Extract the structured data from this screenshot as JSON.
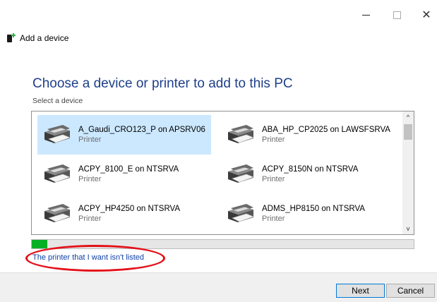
{
  "window": {
    "controls": {
      "minimize": "",
      "maximize": "",
      "close": "✕"
    }
  },
  "header": {
    "icon": "add-device-icon",
    "title": "Add a device"
  },
  "main": {
    "title": "Choose a device or printer to add to this PC",
    "subtitle": "Select a device"
  },
  "device_list": {
    "items": [
      {
        "name": "A_Gaudi_CRO123_P on APSRV06",
        "type": "Printer",
        "icon": "printer-icon",
        "selected": true
      },
      {
        "name": "ABA_HP_CP2025 on LAWSFSRVA",
        "type": "Printer",
        "icon": "printer-icon",
        "selected": false
      },
      {
        "name": "ACPY_8100_E on NTSRVA",
        "type": "Printer",
        "icon": "printer-icon",
        "selected": false
      },
      {
        "name": "ACPY_8150N on NTSRVA",
        "type": "Printer",
        "icon": "printer-icon",
        "selected": false
      },
      {
        "name": "ACPY_HP4250 on NTSRVA",
        "type": "Printer",
        "icon": "printer-icon",
        "selected": false
      },
      {
        "name": "ADMS_HP8150 on NTSRVA",
        "type": "Printer",
        "icon": "printer-icon",
        "selected": false
      }
    ],
    "scroll_up": "^",
    "scroll_down": "v"
  },
  "progress": {
    "value_percent": 4,
    "color": "#06b025"
  },
  "link": {
    "text": "The printer that I want isn't listed"
  },
  "footer": {
    "next_label": "Next",
    "cancel_label": "Cancel"
  },
  "colors": {
    "title": "#1e3f8a",
    "link": "#0f3fa8",
    "selection": "#cce8ff",
    "annotation": "#e3121a"
  }
}
